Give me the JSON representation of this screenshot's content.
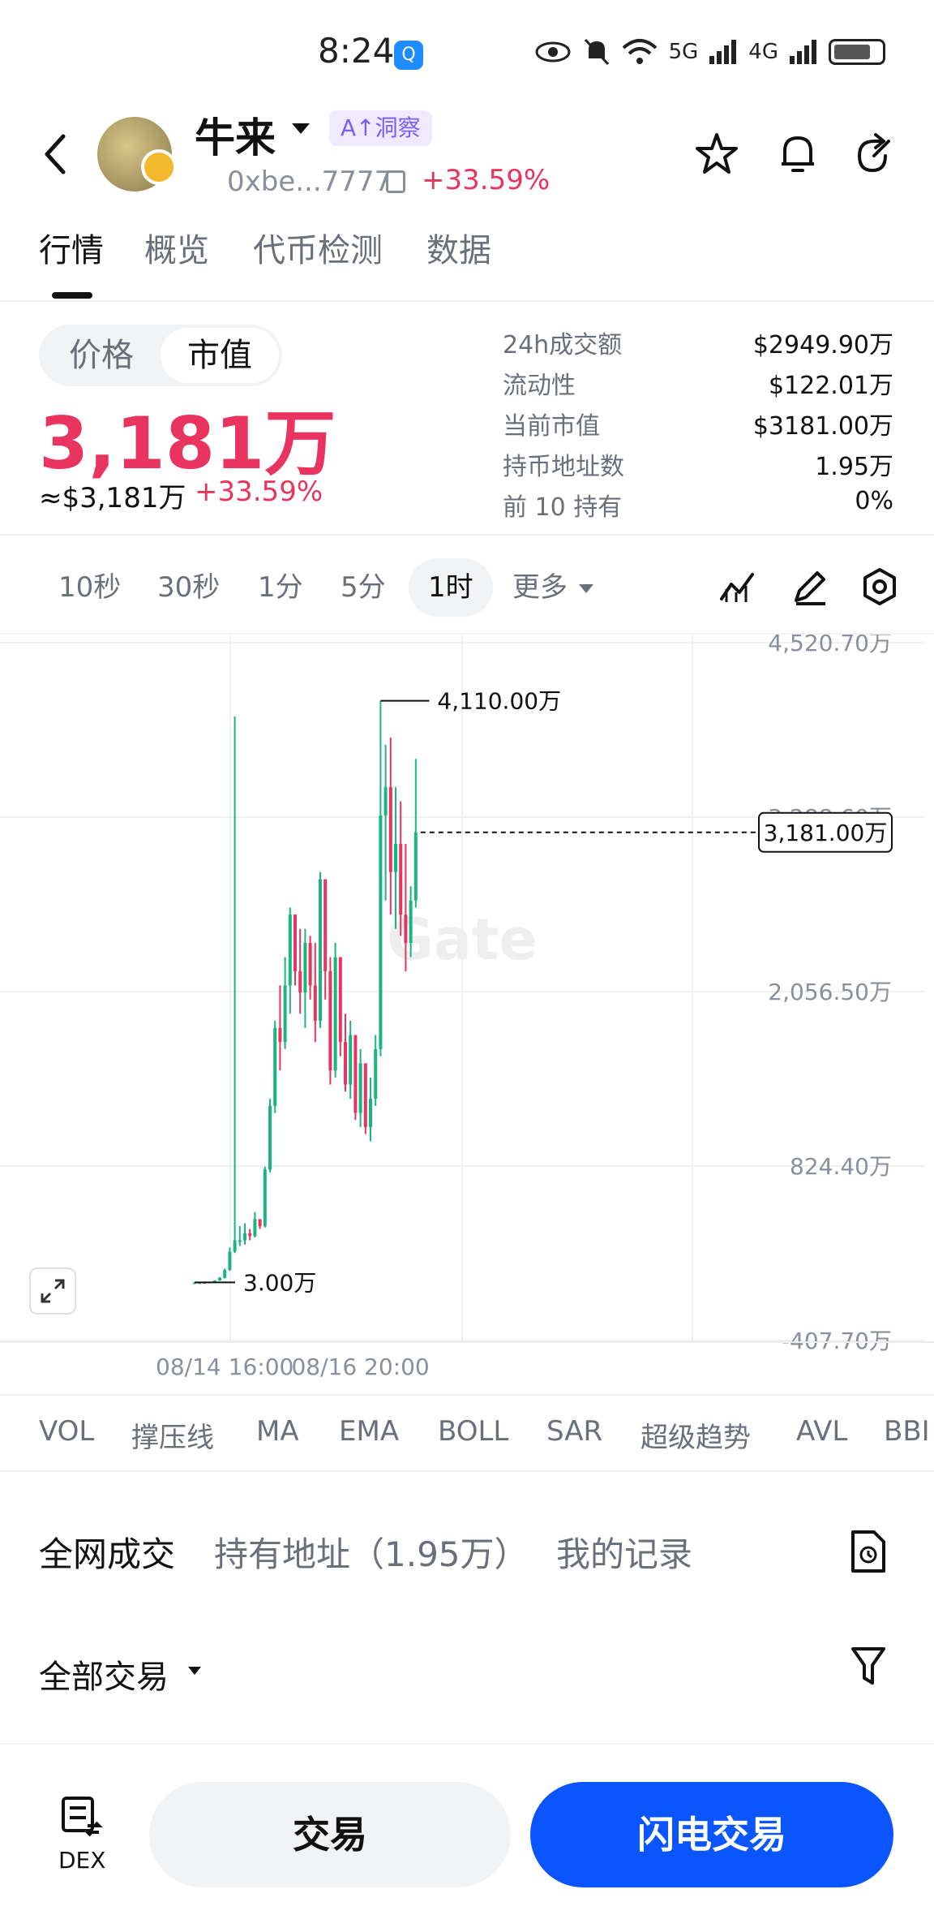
{
  "status": {
    "time": "8:24",
    "network1": "5G",
    "network2": "4G"
  },
  "header": {
    "token_name": "牛来",
    "ai_badge": "A↑洞察",
    "address": "0xbe...7777",
    "change": "+33.59%"
  },
  "tabs": [
    "行情",
    "概览",
    "代币检测",
    "数据"
  ],
  "summary": {
    "toggle": [
      "价格",
      "市值"
    ],
    "market_cap": "3,181万",
    "usd_value": "≈$3,181万",
    "change": "+33.59%",
    "stats": [
      {
        "label": "24h成交额",
        "value": "$2949.90万"
      },
      {
        "label": "流动性",
        "value": "$122.01万"
      },
      {
        "label": "当前市值",
        "value": "$3181.00万"
      },
      {
        "label": "持币地址数",
        "value": "1.95万"
      },
      {
        "label": "前 10 持有",
        "value": "0%"
      }
    ]
  },
  "intervals": [
    "10秒",
    "30秒",
    "1分",
    "5分",
    "1时",
    "更多"
  ],
  "active_interval": "1时",
  "chart_data": {
    "type": "candlestick",
    "watermark": "Gate",
    "y_ticks": [
      4520.7,
      3288.6,
      2056.5,
      824.4,
      -407.7
    ],
    "y_tick_labels": [
      "4,520.70万",
      "3,288.60万",
      "2,056.50万",
      "824.40万",
      "-407.70万"
    ],
    "ylim": [
      -407.7,
      4520.7
    ],
    "x_tick_labels": [
      "08/14 16:00",
      "08/16 20:00"
    ],
    "x_tick_index": [
      6,
      33
    ],
    "high_label": "4,110.00万",
    "low_label": "3.00万",
    "current_label": "3,181.00万",
    "current_value": 3181.0,
    "colors": {
      "up": "#1bb580",
      "down": "#e8345f"
    },
    "candles": [
      [
        3,
        3,
        3,
        3
      ],
      [
        3,
        3,
        3,
        3
      ],
      [
        5,
        5,
        3,
        3
      ],
      [
        3,
        8,
        3,
        8
      ],
      [
        8,
        18,
        8,
        16
      ],
      [
        16,
        40,
        14,
        35
      ],
      [
        35,
        100,
        30,
        90
      ],
      [
        90,
        250,
        85,
        220
      ],
      [
        220,
        4000,
        210,
        300
      ],
      [
        300,
        400,
        260,
        300
      ],
      [
        300,
        420,
        270,
        350
      ],
      [
        350,
        380,
        300,
        330
      ],
      [
        330,
        500,
        320,
        450
      ],
      [
        450,
        420,
        380,
        400
      ],
      [
        400,
        820,
        390,
        800
      ],
      [
        800,
        1300,
        780,
        1250
      ],
      [
        1250,
        1850,
        1200,
        1800
      ],
      [
        1800,
        2100,
        1500,
        1700
      ],
      [
        1700,
        2300,
        1650,
        2100
      ],
      [
        2100,
        2650,
        1900,
        2600
      ],
      [
        2600,
        2600,
        2100,
        2200
      ],
      [
        2200,
        2500,
        1900,
        2050
      ],
      [
        2050,
        2500,
        1800,
        2400
      ],
      [
        2400,
        2450,
        2000,
        2100
      ],
      [
        2100,
        2400,
        1700,
        1850
      ],
      [
        1850,
        2900,
        1800,
        2850
      ],
      [
        2850,
        2700,
        2000,
        2200
      ],
      [
        2200,
        2300,
        1400,
        1500
      ],
      [
        1500,
        2400,
        1450,
        2300
      ],
      [
        2300,
        2250,
        1600,
        1700
      ],
      [
        1700,
        1900,
        1350,
        1400
      ],
      [
        1400,
        1850,
        1300,
        1750
      ],
      [
        1750,
        1700,
        1150,
        1200
      ],
      [
        1200,
        1650,
        1100,
        1550
      ],
      [
        1550,
        1550,
        1050,
        1100
      ],
      [
        1100,
        1450,
        1000,
        1300
      ],
      [
        1300,
        1750,
        1250,
        1650
      ],
      [
        1650,
        4110,
        1600,
        3300
      ],
      [
        3300,
        3800,
        2700,
        3500
      ],
      [
        3500,
        3850,
        2600,
        2900
      ],
      [
        2900,
        3500,
        2500,
        3100
      ],
      [
        3100,
        3400,
        2450,
        2600
      ],
      [
        2600,
        3100,
        2200,
        2400
      ],
      [
        2400,
        2800,
        2300,
        2700
      ],
      [
        2700,
        3700,
        2650,
        3181
      ]
    ]
  },
  "indicators": [
    "VOL",
    "撑压线",
    "MA",
    "EMA",
    "BOLL",
    "SAR",
    "超级趋势",
    "AVL",
    "BBI"
  ],
  "trade_tabs": [
    "全网成交",
    "持有地址（1.95万）",
    "我的记录"
  ],
  "filter_label": "全部交易",
  "bottom": {
    "dex_label": "DEX",
    "trade_label": "交易",
    "flash_label": "闪电交易"
  }
}
